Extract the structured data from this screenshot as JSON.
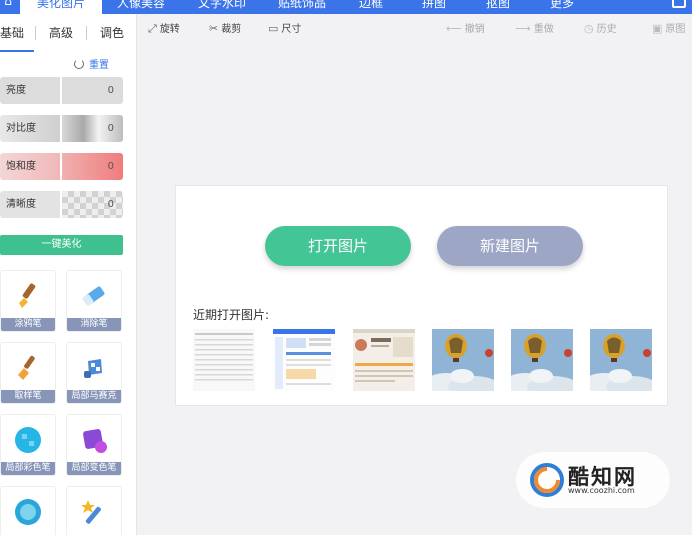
{
  "topnav": {
    "tabs": [
      {
        "label": "美化图片",
        "active": true
      },
      {
        "label": "人像美容"
      },
      {
        "label": "文字水印"
      },
      {
        "label": "贴纸饰品"
      },
      {
        "label": "边框"
      },
      {
        "label": "拼图"
      },
      {
        "label": "抠图"
      },
      {
        "label": "更多"
      }
    ]
  },
  "sidebar": {
    "subtabs": [
      "基础",
      "高级",
      "调色"
    ],
    "reset_label": "重置",
    "adjustments": [
      {
        "label": "亮度",
        "value": "0"
      },
      {
        "label": "对比度",
        "value": "0"
      },
      {
        "label": "饱和度",
        "value": "0"
      },
      {
        "label": "清晰度",
        "value": "0"
      }
    ],
    "auto_beautify": "一键美化",
    "tools": [
      {
        "label": "涂鸦笔",
        "icon": "paintbrush-icon"
      },
      {
        "label": "消除笔",
        "icon": "eraser-icon"
      },
      {
        "label": "取样笔",
        "icon": "sample-brush-icon"
      },
      {
        "label": "局部马赛克",
        "icon": "mosaic-brush-icon"
      },
      {
        "label": "局部彩色笔",
        "icon": "color-brush-icon"
      },
      {
        "label": "局部变色笔",
        "icon": "recolor-brush-icon"
      },
      {
        "label": "",
        "icon": "blur-brush-icon"
      },
      {
        "label": "",
        "icon": "magic-wand-icon"
      }
    ]
  },
  "toolbar": {
    "rotate": "旋转",
    "crop": "裁剪",
    "size": "尺寸",
    "undo": "撤销",
    "redo": "重做",
    "history": "历史",
    "compare": "原图"
  },
  "canvas": {
    "open_button": "打开图片",
    "new_button": "新建图片",
    "recent_label": "近期打开图片:"
  },
  "watermark": {
    "name": "酷知网",
    "url": "www.coozhi.com"
  },
  "colors": {
    "accent_blue": "#3a74e8",
    "green": "#43c595",
    "lavender": "#9ea6c6",
    "tool_label_bg": "#8795b8"
  }
}
